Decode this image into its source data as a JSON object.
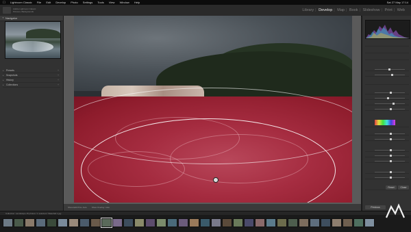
{
  "menubar": {
    "apple": "",
    "items": [
      "Lightroom Classic",
      "File",
      "Edit",
      "Develop",
      "Photo",
      "Settings",
      "Tools",
      "View",
      "Window",
      "Help"
    ],
    "status_right": "Sat 27 May 17:14"
  },
  "identity": {
    "line1": "Adobe Lightroom Classic",
    "line2": "Pictures, Backgrounds"
  },
  "modules": {
    "items": [
      "Library",
      "Develop",
      "Map",
      "Book",
      "Slideshow",
      "Print",
      "Web"
    ],
    "active": "Develop"
  },
  "left_panel": {
    "navigator_label": "Navigator",
    "sections": [
      "Presets",
      "Snapshots",
      "History",
      "Collections"
    ],
    "copy_label": "Copy...",
    "paste_label": "Paste"
  },
  "toolbar": {
    "left": "Show Edit Pins: Auto",
    "right": "Show Overlay: Auto"
  },
  "right_panel": {
    "title": "Histogram",
    "reset_label": "Reset",
    "close_label": "Close",
    "previous_label": "Previous",
    "reset_bottom_label": "Reset"
  },
  "filmstrip_bar": {
    "text": "Collection: Landscape    15 photos / 1 selected / Waterfall 1.jpg"
  },
  "colors": {
    "mask_overlay": "#a52c40",
    "active_module": "#e8e8e8"
  },
  "thumb_colors": [
    "#6d7a85",
    "#4a5a4a",
    "#8a7a6a",
    "#5b6b7b",
    "#3a4a3a",
    "#7a8a9a",
    "#9a8a7a",
    "#4b5b6b",
    "#6a5a4a",
    "#5a6a5a",
    "#7a6a8a",
    "#3d4d5d",
    "#8a8a6a",
    "#5c4c6c",
    "#7b8b6b",
    "#4a6a7a",
    "#6b5b7b",
    "#9a7a5a",
    "#3a5a6a",
    "#7a7a8a",
    "#5a4a3a",
    "#6a7a5a",
    "#4a4a6a",
    "#8a6a6a",
    "#5b7b8b",
    "#6c6c4c",
    "#4d5d4d",
    "#7d6d5d",
    "#5e6e7e",
    "#3e4e5e",
    "#8e7e6e",
    "#6f5f4f",
    "#4f6f5f",
    "#7f8f9f",
    "#5f4f6f",
    "#9f8f7f",
    "#3f5f4f"
  ]
}
